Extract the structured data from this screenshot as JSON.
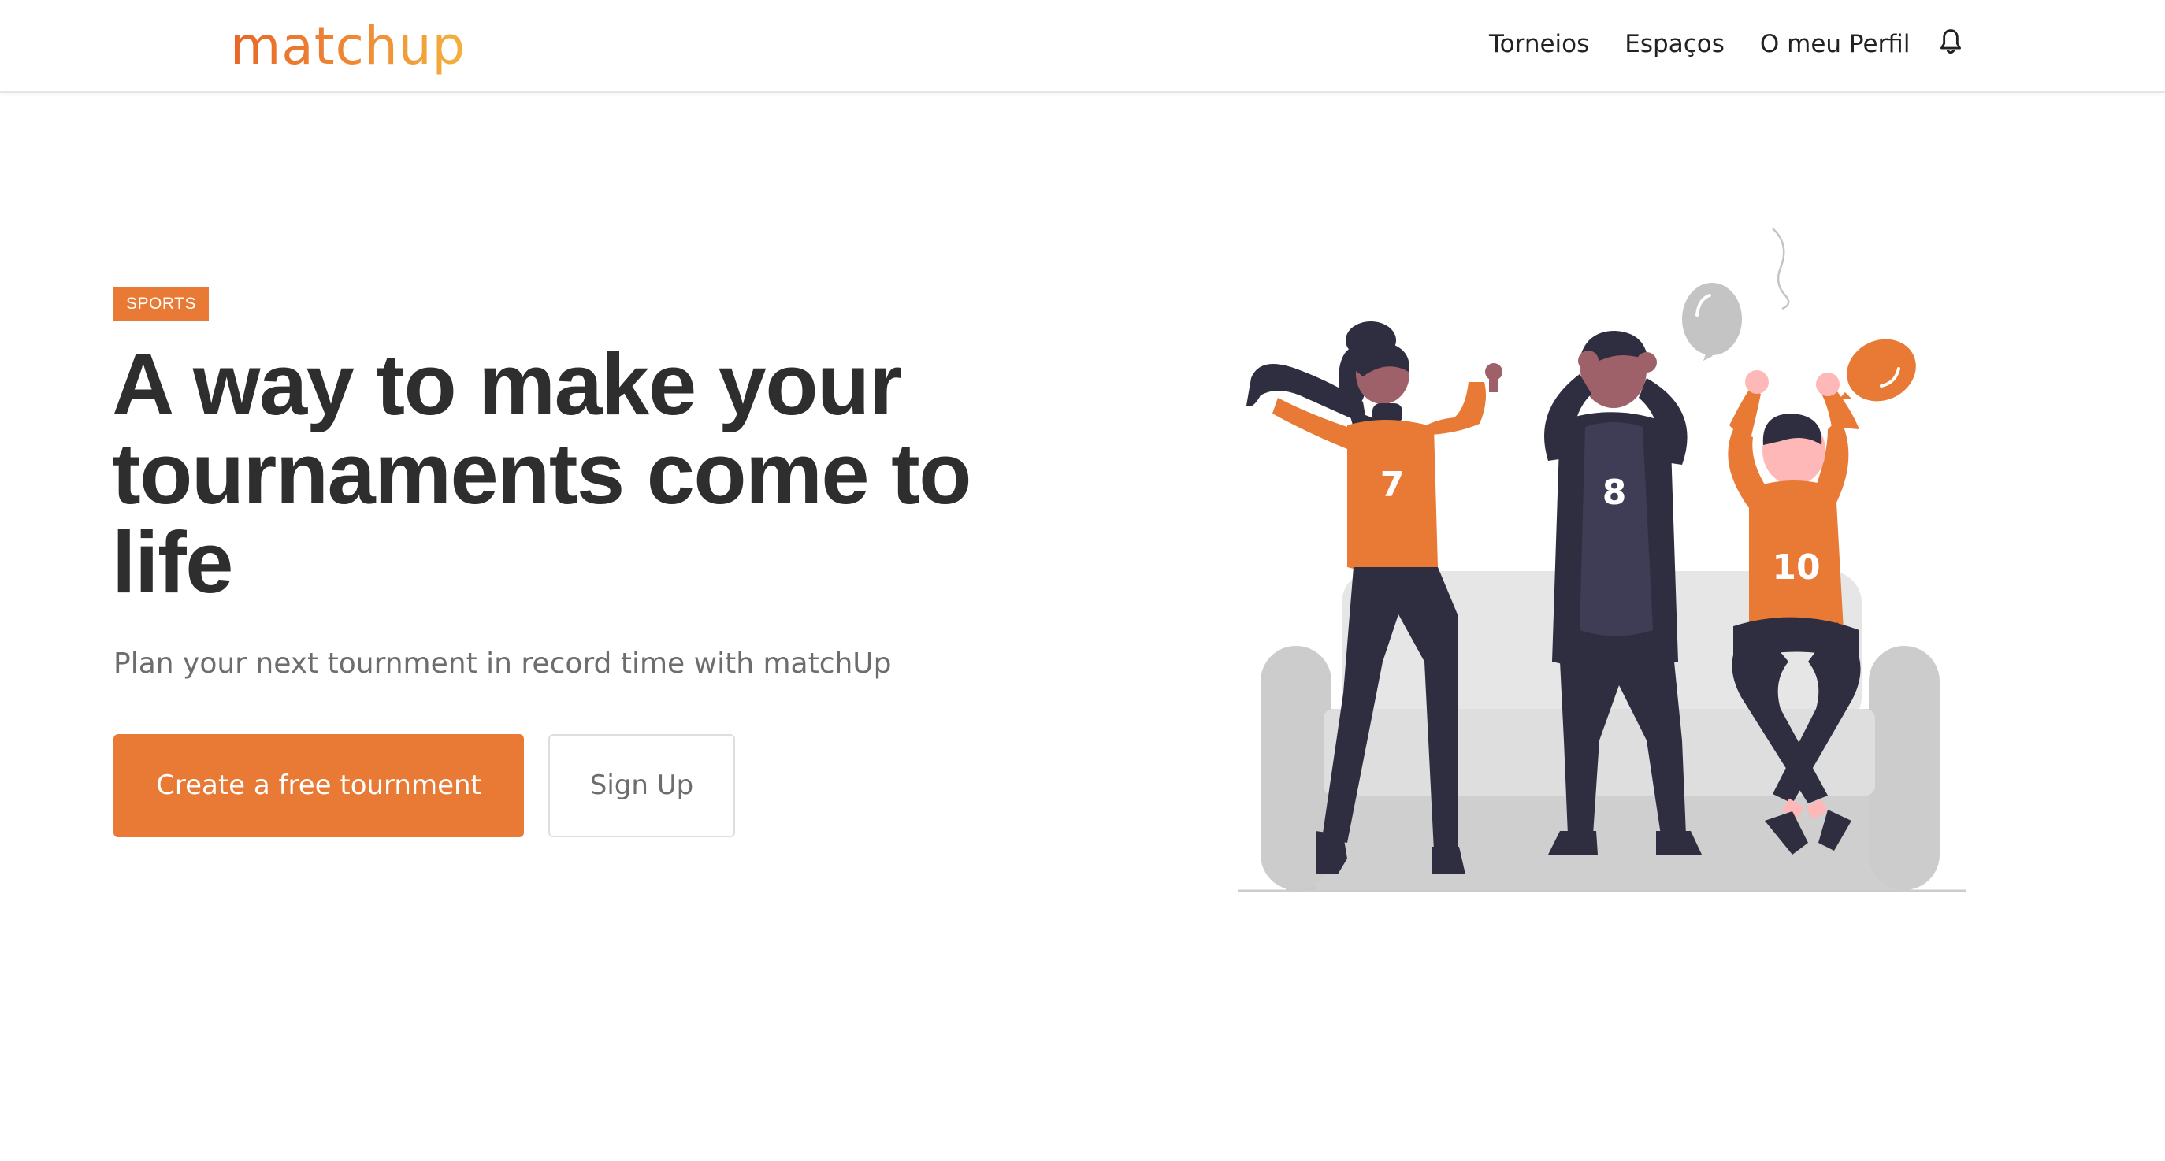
{
  "navbar": {
    "logo": "matchup",
    "links": [
      "Torneios",
      "Espaços",
      "O meu Perfil"
    ],
    "notification_icon": "bell-icon"
  },
  "hero": {
    "badge": "SPORTS",
    "headline_lines": [
      "A way to make your",
      "tournaments come to",
      "life"
    ],
    "subtitle": "Plan your next tournment in record time with matchUp",
    "primary_button": "Create a free tournment",
    "secondary_button": "Sign Up"
  },
  "illustration": {
    "jersey_numbers": [
      "7",
      "8",
      "10"
    ]
  },
  "colors": {
    "accent": "#e97a35",
    "heading": "#2e2e2e",
    "muted_text": "#6d6d6d",
    "dark_figure": "#2f2e41",
    "sofa": "#e6e6e6"
  }
}
